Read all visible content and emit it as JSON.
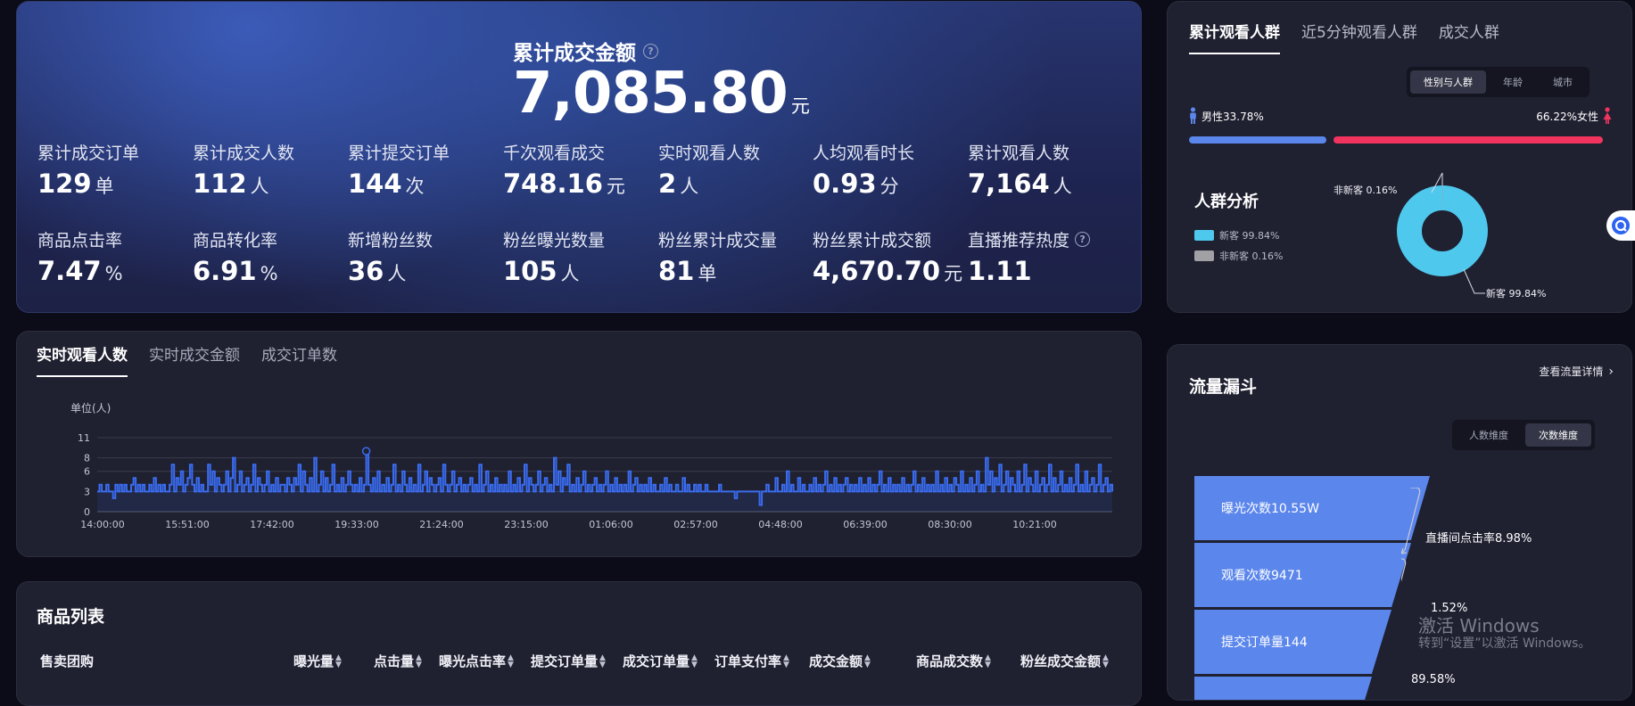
{
  "stats": {
    "hero_title": "累计成交金额",
    "hero_value": "7,085.80",
    "hero_unit": "元",
    "row1": [
      {
        "label": "累计成交订单",
        "value": "129",
        "unit": "单"
      },
      {
        "label": "累计成交人数",
        "value": "112",
        "unit": "人"
      },
      {
        "label": "累计提交订单",
        "value": "144",
        "unit": "次"
      },
      {
        "label": "千次观看成交",
        "value": "748.16",
        "unit": "元"
      },
      {
        "label": "实时观看人数",
        "value": "2",
        "unit": "人"
      },
      {
        "label": "人均观看时长",
        "value": "0.93",
        "unit": "分"
      },
      {
        "label": "累计观看人数",
        "value": "7,164",
        "unit": "人"
      }
    ],
    "row2": [
      {
        "label": "商品点击率",
        "value": "7.47",
        "unit": "%"
      },
      {
        "label": "商品转化率",
        "value": "6.91",
        "unit": "%"
      },
      {
        "label": "新增粉丝数",
        "value": "36",
        "unit": "人"
      },
      {
        "label": "粉丝曝光数量",
        "value": "105",
        "unit": "人"
      },
      {
        "label": "粉丝累计成交量",
        "value": "81",
        "unit": "单"
      },
      {
        "label": "粉丝累计成交额",
        "value": "4,670.70",
        "unit": "元"
      },
      {
        "label": "直播推荐热度",
        "value": "1.11",
        "unit": ""
      }
    ]
  },
  "trend": {
    "tabs": [
      "实时观看人数",
      "实时成交金额",
      "成交订单数"
    ]
  },
  "chart_data": {
    "type": "line",
    "ylabel": "单位(人)",
    "ylim": [
      0,
      11
    ],
    "yticks": [
      "0",
      "3",
      "6",
      "8",
      "11"
    ],
    "xticks": [
      "14:00:00",
      "15:51:00",
      "17:42:00",
      "19:33:00",
      "21:24:00",
      "23:15:00",
      "01:06:00",
      "02:57:00",
      "04:48:00",
      "06:39:00",
      "08:30:00",
      "10:21:00"
    ],
    "color": "#3a6cf0",
    "series": [
      {
        "values": [
          3,
          4,
          3,
          3,
          4,
          3,
          3,
          2,
          4,
          3,
          4,
          3,
          4,
          3,
          3,
          4,
          5,
          3,
          4,
          3,
          4,
          3,
          3,
          4,
          3,
          5,
          3,
          4,
          3,
          4,
          3,
          3,
          4,
          7,
          3,
          5,
          4,
          6,
          3,
          4,
          5,
          7,
          4,
          3,
          5,
          3,
          4,
          3,
          3,
          7,
          4,
          6,
          3,
          5,
          4,
          3,
          4,
          6,
          3,
          5,
          8,
          3,
          4,
          6,
          3,
          4,
          5,
          3,
          4,
          7,
          3,
          5,
          4,
          3,
          4,
          6,
          3,
          4,
          3,
          5,
          3,
          4,
          4,
          3,
          5,
          4,
          3,
          5,
          4,
          7,
          3,
          6,
          4,
          3,
          5,
          3,
          8,
          3,
          4,
          6,
          3,
          5,
          3,
          4,
          7,
          3,
          4,
          3,
          5,
          3,
          4,
          6,
          4,
          3,
          4,
          3,
          5,
          3,
          4,
          9,
          4,
          3,
          5,
          3,
          6,
          3,
          4,
          3,
          5,
          3,
          4,
          7,
          3,
          4,
          3,
          6,
          4,
          3,
          5,
          3,
          4,
          3,
          7,
          3,
          4,
          6,
          3,
          5,
          4,
          3,
          4,
          5,
          3,
          7,
          4,
          3,
          4,
          6,
          3,
          4,
          5,
          3,
          4,
          3,
          4,
          5,
          3,
          4,
          3,
          7,
          3,
          4,
          6,
          3,
          4,
          3,
          5,
          3,
          4,
          3,
          4,
          3,
          6,
          3,
          4,
          3,
          5,
          3,
          4,
          7,
          3,
          5,
          4,
          3,
          4,
          6,
          3,
          4,
          5,
          3,
          4,
          3,
          8,
          4,
          6,
          3,
          5,
          4,
          7,
          3,
          4,
          3,
          5,
          3,
          4,
          6,
          3,
          4,
          3,
          4,
          5,
          3,
          4,
          3,
          4,
          6,
          3,
          4,
          3,
          5,
          3,
          4,
          3,
          4,
          3,
          6,
          3,
          4,
          5,
          3,
          4,
          3,
          4,
          3,
          5,
          3,
          4,
          3,
          3,
          4,
          3,
          5,
          3,
          4,
          3,
          3,
          4,
          3,
          3,
          5,
          3,
          4,
          3,
          3,
          4,
          3,
          4,
          3,
          3,
          4,
          3,
          3,
          3,
          3,
          3,
          4,
          3,
          3,
          3,
          3,
          3,
          3,
          2,
          3,
          3,
          3,
          3,
          3,
          3,
          3,
          3,
          3,
          3,
          1,
          3,
          3,
          4,
          3,
          3,
          3,
          5,
          3,
          3,
          4,
          3,
          6,
          3,
          4,
          3,
          3,
          5,
          3,
          4,
          3,
          3,
          4,
          3,
          5,
          3,
          4,
          3,
          4,
          6,
          3,
          4,
          3,
          5,
          3,
          4,
          3,
          4,
          5,
          3,
          4,
          3,
          4,
          3,
          5,
          3,
          4,
          3,
          5,
          3,
          4,
          3,
          4,
          6,
          3,
          4,
          3,
          5,
          3,
          4,
          3,
          4,
          3,
          5,
          3,
          4,
          3,
          4,
          6,
          3,
          4,
          3,
          5,
          3,
          4,
          3,
          4,
          3,
          6,
          3,
          4,
          3,
          5,
          3,
          4,
          3,
          5,
          4,
          3,
          6,
          3,
          4,
          3,
          5,
          3,
          4,
          6,
          3,
          4,
          3,
          8,
          4,
          6,
          3,
          5,
          4,
          7,
          3,
          4,
          6,
          3,
          5,
          4,
          3,
          6,
          3,
          4,
          7,
          3,
          5,
          4,
          3,
          6,
          3,
          4,
          5,
          3,
          4,
          7,
          3,
          5,
          3,
          4,
          6,
          3,
          4,
          3,
          5,
          3,
          4,
          7,
          3,
          4,
          3,
          6,
          3,
          4,
          5,
          3,
          4,
          7,
          3,
          4,
          5,
          3,
          4,
          3
        ]
      }
    ]
  },
  "products": {
    "title": "商品列表",
    "columns": [
      "售卖团购",
      "曝光量",
      "点击量",
      "曝光点击率",
      "提交订单量",
      "成交订单量",
      "订单支付率",
      "成交金额",
      "商品成交数",
      "粉丝成交金额"
    ]
  },
  "audience": {
    "tabs": [
      "累计观看人群",
      "近5分钟观看人群",
      "成交人群"
    ],
    "segments": [
      "性别与人群",
      "年龄",
      "城市"
    ],
    "male_label": "男性33.78%",
    "female_label": "66.22%女性",
    "male_share": 0.3378,
    "female_share": 0.6622,
    "male_color": "#5b86ec",
    "female_color": "#f0345e",
    "section_title": "人群分析",
    "legend": [
      {
        "name": "新客 99.84%",
        "color": "#4fc8ee"
      },
      {
        "name": "非新客 0.16%",
        "color": "#a1a1a5"
      }
    ],
    "pie_label_small": "非新客 0.16%",
    "pie_label_big": "新客 99.84%",
    "pie": [
      {
        "name": "新客",
        "value": 99.84,
        "color": "#4fc8ee"
      },
      {
        "name": "非新客",
        "value": 0.16,
        "color": "#a1a1a5"
      }
    ]
  },
  "funnel": {
    "title": "流量漏斗",
    "link": "查看流量详情",
    "segments": [
      "人数维度",
      "次数维度"
    ],
    "steps": [
      {
        "label": "曝光次数10.55W"
      },
      {
        "label": "观看次数9471"
      },
      {
        "label": "提交订单量144"
      }
    ],
    "rates": [
      "直播间点击率8.98%",
      "1.52%",
      "89.58%"
    ]
  },
  "watermark": {
    "line1": "激活 Windows",
    "line2": "转到“设置”以激活 Windows。"
  }
}
